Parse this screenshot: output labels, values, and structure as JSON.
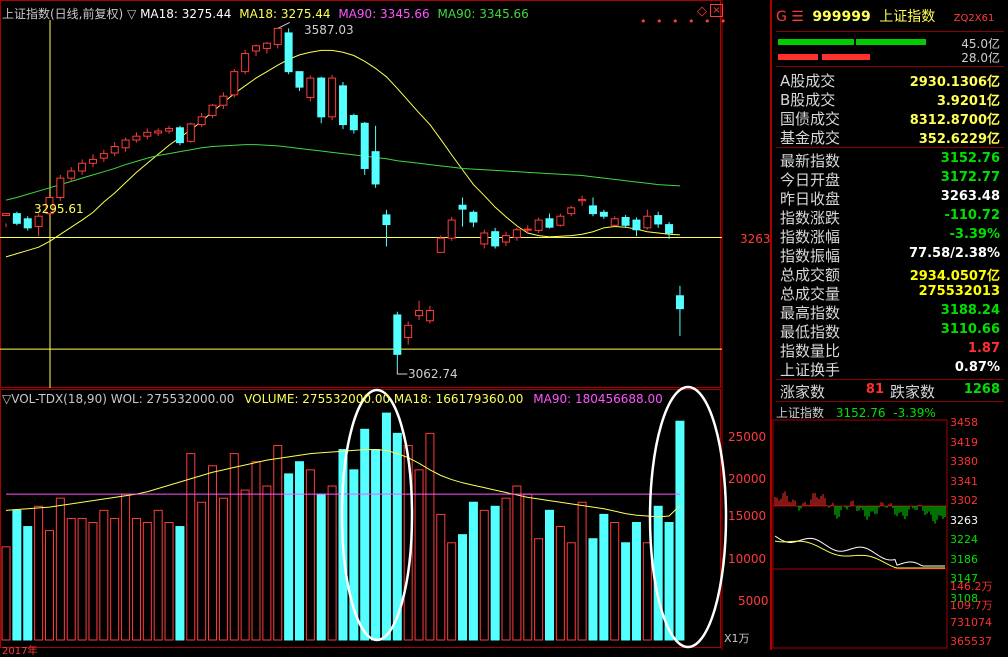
{
  "colors": {
    "up": "#ff3c3c",
    "down": "#54ffff",
    "ma18": "#ffff54",
    "ma90": "#40d840",
    "vol_ma90": "#ff54ff",
    "frame": "#aa0000",
    "yellow": "#ffff00",
    "green": "#00e000",
    "red": "#ff3030"
  },
  "top_header": {
    "title": "上证指数(日线,前复权)",
    "ma_marker": "▽",
    "ma18_label": "MA18: 3275.44",
    "ma18b_label": "MA18: 3275.44",
    "ma90_label": "MA90: 3345.66",
    "ma90b_label": "MA90: 3345.66"
  },
  "price_annotations": {
    "high": "3587.03",
    "low": "3062.74",
    "ref_left": "3295.61",
    "right_price": "3263"
  },
  "vol_header": {
    "label": "▽VOL-TDX(18,90) WOL: 275532000.00",
    "volume": "VOLUME: 275532000.00",
    "ma18": "MA18: 166179360.00",
    "ma90": "MA90: 180456688.00"
  },
  "vol_axis": [
    "25000",
    "20000",
    "15000",
    "10000",
    "5000"
  ],
  "vol_unit": "X1万",
  "bottom_date": "2017年",
  "panel": {
    "code_prefix": "G ☰",
    "code": "999999",
    "name": "上证指数",
    "tag": "ZQ2X61",
    "bar1_value": "45.0亿",
    "bar2_value": "28.0亿",
    "turnover": [
      {
        "label": "A股成交",
        "value": "2930.1306亿"
      },
      {
        "label": "B股成交",
        "value": "3.9201亿"
      },
      {
        "label": "国债成交",
        "value": "8312.8700亿"
      },
      {
        "label": "基金成交",
        "value": "352.6229亿"
      }
    ],
    "stats": [
      {
        "label": "最新指数",
        "value": "3152.76",
        "color": "#00e000"
      },
      {
        "label": "今日开盘",
        "value": "3172.77",
        "color": "#00e000"
      },
      {
        "label": "昨日收盘",
        "value": "3263.48",
        "color": "#ffffff"
      },
      {
        "label": "指数涨跌",
        "value": "-110.72",
        "color": "#00e000"
      },
      {
        "label": "指数涨幅",
        "value": "-3.39%",
        "color": "#00e000"
      },
      {
        "label": "指数振幅",
        "value": "77.58/2.38%",
        "color": "#ffffff"
      },
      {
        "label": "总成交额",
        "value": "2934.0507亿",
        "color": "#ffff00"
      },
      {
        "label": "总成交量",
        "value": "275532013",
        "color": "#ffff00"
      },
      {
        "label": "最高指数",
        "value": "3188.24",
        "color": "#00e000"
      },
      {
        "label": "最低指数",
        "value": "3110.66",
        "color": "#00e000"
      },
      {
        "label": "指数量比",
        "value": "1.87",
        "color": "#ff3030"
      },
      {
        "label": "上证换手",
        "value": "0.87%",
        "color": "#ffffff"
      }
    ],
    "up_label": "涨家数",
    "up_value": "81",
    "down_label": "跌家数",
    "down_value": "1268",
    "mini_title": "上证指数",
    "mini_price": "3152.76",
    "mini_change": "-3.39%",
    "mini_axis": [
      "3458",
      "3419",
      "3380",
      "3341",
      "3302",
      "3263",
      "3224",
      "3186",
      "3147",
      "3108"
    ],
    "mini_vol_axis": [
      "146.2万",
      "109.7万",
      "731074",
      "365537"
    ]
  },
  "chart_data": {
    "type": "candlestick",
    "price_range": [
      3050,
      3600
    ],
    "volume_unit": "万",
    "volume_range": [
      0,
      29000
    ],
    "candles": [
      [
        3297,
        3300,
        3285,
        3279
      ],
      [
        3300,
        3285,
        3303,
        3282
      ],
      [
        3292,
        3278,
        3296,
        3274
      ],
      [
        3280,
        3296,
        3300,
        3265
      ],
      [
        3300,
        3325,
        3330,
        3296
      ],
      [
        3325,
        3355,
        3360,
        3320
      ],
      [
        3355,
        3366,
        3372,
        3350
      ],
      [
        3366,
        3378,
        3384,
        3360
      ],
      [
        3378,
        3384,
        3392,
        3372
      ],
      [
        3386,
        3393,
        3399,
        3380
      ],
      [
        3394,
        3404,
        3411,
        3389
      ],
      [
        3402,
        3414,
        3418,
        3396
      ],
      [
        3414,
        3420,
        3426,
        3410
      ],
      [
        3420,
        3426,
        3432,
        3415
      ],
      [
        3425,
        3428,
        3432,
        3420
      ],
      [
        3428,
        3432,
        3436,
        3424
      ],
      [
        3433,
        3410,
        3436,
        3406
      ],
      [
        3412,
        3439,
        3441,
        3410
      ],
      [
        3438,
        3450,
        3456,
        3434
      ],
      [
        3452,
        3468,
        3470,
        3448
      ],
      [
        3468,
        3482,
        3488,
        3462
      ],
      [
        3484,
        3520,
        3524,
        3480
      ],
      [
        3520,
        3548,
        3554,
        3516
      ],
      [
        3552,
        3560,
        3562,
        3544
      ],
      [
        3556,
        3564,
        3566,
        3548
      ],
      [
        3562,
        3587,
        3587,
        3556
      ],
      [
        3580,
        3520,
        3587,
        3516
      ],
      [
        3520,
        3496,
        3520,
        3490
      ],
      [
        3480,
        3510,
        3514,
        3474
      ],
      [
        3510,
        3450,
        3512,
        3440
      ],
      [
        3450,
        3510,
        3515,
        3445
      ],
      [
        3498,
        3438,
        3504,
        3431
      ],
      [
        3452,
        3430,
        3455,
        3424
      ],
      [
        3440,
        3370,
        3442,
        3360
      ],
      [
        3396,
        3346,
        3436,
        3340
      ],
      [
        3298,
        3283,
        3306,
        3249
      ],
      [
        3143,
        3082,
        3148,
        3062
      ],
      [
        3108,
        3127,
        3133,
        3097
      ],
      [
        3142,
        3150,
        3165,
        3135
      ],
      [
        3134,
        3150,
        3157,
        3130
      ],
      [
        3240,
        3262,
        3266,
        3240
      ],
      [
        3262,
        3290,
        3295,
        3258
      ],
      [
        3313,
        3307,
        3325,
        3280
      ],
      [
        3302,
        3287,
        3305,
        3279
      ],
      [
        3253,
        3270,
        3275,
        3246
      ],
      [
        3272,
        3250,
        3278,
        3246
      ],
      [
        3256,
        3266,
        3272,
        3250
      ],
      [
        3263,
        3275,
        3278,
        3258
      ],
      [
        3275,
        3276,
        3282,
        3270
      ],
      [
        3274,
        3290,
        3294,
        3270
      ],
      [
        3292,
        3279,
        3300,
        3277
      ],
      [
        3282,
        3296,
        3300,
        3280
      ],
      [
        3300,
        3309,
        3312,
        3296
      ],
      [
        3320,
        3322,
        3328,
        3312
      ],
      [
        3312,
        3300,
        3325,
        3296
      ],
      [
        3302,
        3296,
        3306,
        3292
      ],
      [
        3282,
        3292,
        3296,
        3280
      ],
      [
        3294,
        3282,
        3298,
        3278
      ],
      [
        3290,
        3275,
        3294,
        3265
      ],
      [
        3278,
        3296,
        3306,
        3275
      ],
      [
        3297,
        3284,
        3303,
        3278
      ],
      [
        3283,
        3270,
        3287,
        3261
      ],
      [
        3172.77,
        3152.76,
        3188.24,
        3110.66
      ]
    ],
    "ma18": [
      3233,
      3238,
      3243,
      3248,
      3257,
      3268,
      3279,
      3290,
      3302,
      3318,
      3332,
      3348,
      3364,
      3378,
      3392,
      3406,
      3418,
      3430,
      3443,
      3458,
      3472,
      3486,
      3498,
      3510,
      3520,
      3530,
      3539,
      3546,
      3550,
      3553,
      3553,
      3550,
      3545,
      3536,
      3525,
      3512,
      3494,
      3475,
      3456,
      3438,
      3415,
      3391,
      3368,
      3345,
      3328,
      3310,
      3295,
      3281,
      3270,
      3266,
      3264,
      3265,
      3266,
      3268,
      3272,
      3278,
      3280,
      3279,
      3276,
      3272,
      3270,
      3268,
      3267
    ],
    "ma90": [
      3321,
      3325,
      3330,
      3335,
      3340,
      3345,
      3350,
      3355,
      3360,
      3365,
      3370,
      3376,
      3381,
      3386,
      3390,
      3393,
      3396,
      3399,
      3402,
      3404,
      3405,
      3406,
      3407,
      3407,
      3406,
      3405,
      3403,
      3401,
      3399,
      3397,
      3395,
      3393,
      3391,
      3389,
      3387,
      3385,
      3382,
      3380,
      3378,
      3376,
      3374,
      3372,
      3370,
      3369,
      3368,
      3367,
      3366,
      3365,
      3364,
      3363,
      3362,
      3361,
      3360,
      3359,
      3357,
      3355,
      3353,
      3351,
      3349,
      3347,
      3345,
      3344,
      3343
    ],
    "volume": [
      11500,
      16000,
      14000,
      16500,
      13500,
      17500,
      15000,
      15000,
      14500,
      16000,
      15000,
      18000,
      15000,
      14500,
      16000,
      14500,
      14000,
      23000,
      17000,
      21500,
      17500,
      23000,
      18500,
      22000,
      19000,
      24000,
      20500,
      22000,
      21000,
      18000,
      19000,
      23500,
      21000,
      26000,
      23500,
      28000,
      25500,
      24000,
      21000,
      25500,
      15500,
      12000,
      13000,
      17000,
      16000,
      16500,
      17500,
      19000,
      18000,
      12500,
      16000,
      14000,
      12000,
      17000,
      12500,
      15500,
      14500,
      12000,
      14500,
      12000,
      16500,
      14500,
      27000
    ],
    "volume_ma18": [
      16000,
      16100,
      16200,
      16300,
      16400,
      16600,
      16800,
      17000,
      17200,
      17400,
      17600,
      17800,
      18000,
      18300,
      18700,
      19100,
      19500,
      19900,
      20300,
      20700,
      21000,
      21300,
      21600,
      21900,
      22200,
      22400,
      22600,
      22800,
      23000,
      23100,
      23200,
      23300,
      23400,
      23500,
      23500,
      23400,
      23000,
      22500,
      21800,
      21000,
      20300,
      19800,
      19400,
      19100,
      18800,
      18500,
      18200,
      17900,
      17600,
      17400,
      17200,
      17000,
      16800,
      16600,
      16400,
      16200,
      15900,
      15600,
      15400,
      15300,
      15200,
      15300,
      16600
    ],
    "volume_ma90": 18000
  }
}
